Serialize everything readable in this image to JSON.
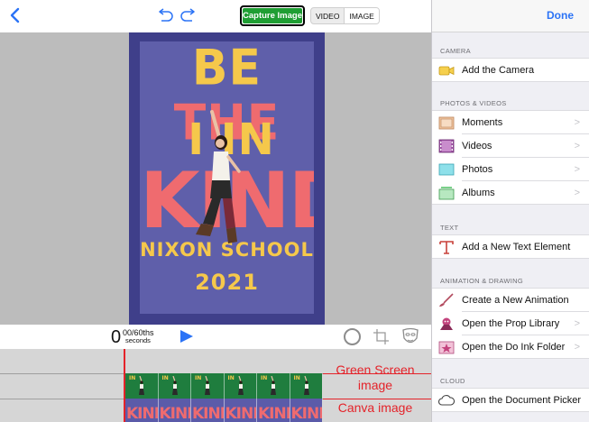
{
  "toolbar": {
    "capture_label": "Capture Image",
    "mode_video": "VIDEO",
    "mode_image": "IMAGE"
  },
  "poster": {
    "line1_a": "BE",
    "line1_b": "THE",
    "line2": "I IN",
    "line3": "KIND",
    "line4": "NIXON SCHOOL",
    "line5": "2021"
  },
  "playback": {
    "frame": "0",
    "fraction": "00/60ths",
    "unit": "seconds"
  },
  "timeline": {
    "green_label_1": "Green Screen",
    "green_label_2": "image",
    "canva_label": "Canva image",
    "green_frame_text": "IN",
    "canva_frame_text": "KIND"
  },
  "panel": {
    "done_label": "Done",
    "sections": {
      "camera": "CAMERA",
      "photos_videos": "PHOTOS & VIDEOS",
      "text": "TEXT",
      "animation": "ANIMATION & DRAWING",
      "cloud": "CLOUD"
    },
    "items": {
      "add_camera": "Add the Camera",
      "moments": "Moments",
      "videos": "Videos",
      "photos": "Photos",
      "albums": "Albums",
      "add_text": "Add a New Text Element",
      "new_animation": "Create a New Animation",
      "prop_library": "Open the Prop Library",
      "do_ink_folder": "Open the Do Ink Folder",
      "document_picker": "Open the Document Picker"
    },
    "chevron": ">"
  },
  "colors": {
    "accent_blue": "#2b73f6",
    "capture_green": "#1f9e33",
    "annotation_red": "#e4232a",
    "poster_blue": "#5f5faa",
    "poster_yellow": "#f5c84b",
    "poster_red": "#ef6b6f"
  },
  "icons": {
    "back": "chevron-left-icon",
    "undo": "undo-icon",
    "redo": "redo-icon",
    "play": "play-icon",
    "circle": "circle-tool-icon",
    "crop": "crop-icon",
    "mask": "mask-icon"
  }
}
